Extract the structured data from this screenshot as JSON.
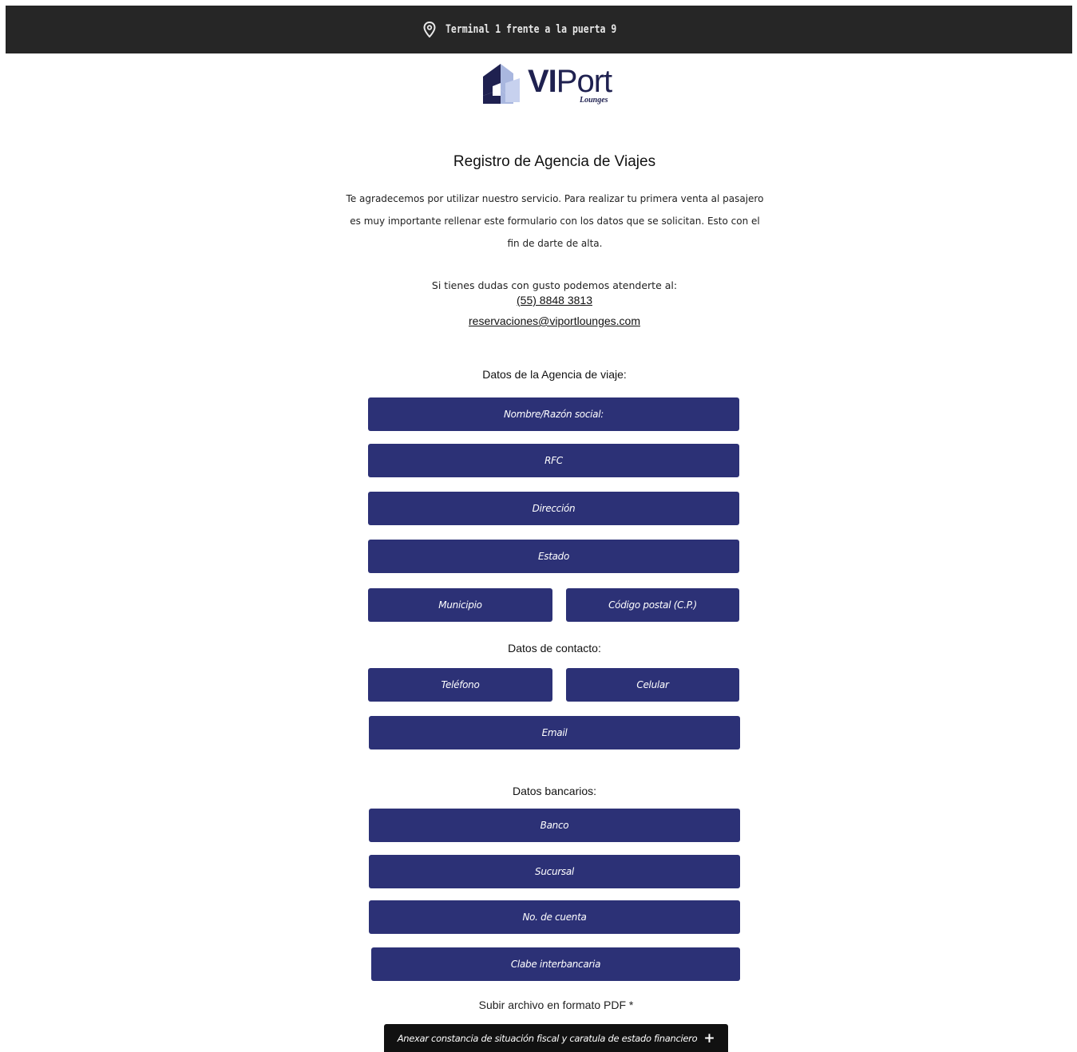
{
  "topbar": {
    "location_icon": "map-pin-icon",
    "location_text": "Terminal 1 frente a la puerta 9"
  },
  "logo": {
    "word_bold": "VI",
    "word_light": "Port",
    "subtitle": "Lounges",
    "colors": {
      "navy": "#1f2150",
      "light_blue": "#a9b7df"
    }
  },
  "page": {
    "title": "Registro de Agencia de Viajes",
    "intro": "Te agradecemos por utilizar nuestro servicio. Para realizar tu primera venta al pasajero es muy importante rellenar este formulario con los datos que se solicitan. Esto con el fin de darte de alta.",
    "help_text": "Si tienes dudas con gusto podemos atenderte al:",
    "phone": "(55) 8848 3813",
    "email": "reservaciones@viportlounges.com"
  },
  "sections": {
    "agency": "Datos de la Agencia de viaje:",
    "contact": "Datos de contacto:",
    "bank": "Datos bancarios:"
  },
  "fields": {
    "nombre": "Nombre/Razón social:",
    "rfc": "RFC",
    "direccion": "Dirección",
    "estado": "Estado",
    "municipio": "Municipio",
    "cp": "Código postal (C.P.)",
    "telefono": "Teléfono",
    "celular": "Celular",
    "email": "Email",
    "banco": "Banco",
    "sucursal": "Sucursal",
    "cuenta": "No. de cuenta",
    "clabe": "Clabe interbancaria"
  },
  "upload": {
    "label": "Subir archivo en formato PDF *",
    "button": "Anexar constancia de situación fiscal y caratula de estado financiero",
    "icon": "plus-icon"
  },
  "colors": {
    "topbar": "#262626",
    "field_bg": "#2c3176",
    "upload_bg": "#111111"
  }
}
